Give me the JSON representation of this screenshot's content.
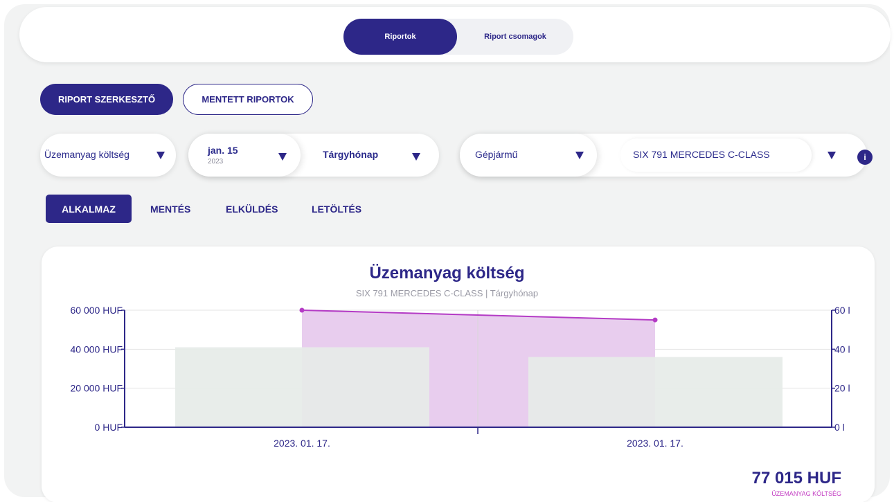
{
  "top_tabs": {
    "reports": "Riportok",
    "packages": "Riport csomagok"
  },
  "mode_buttons": {
    "editor": "RIPORT SZERKESZTŐ",
    "saved": "MENTETT RIPORTOK"
  },
  "filters": {
    "metric": "Üzemanyag költség",
    "date_main": "jan. 15",
    "date_year": "2023",
    "period": "Tárgyhónap",
    "entity_type": "Gépjármű",
    "vehicle": "SIX 791 MERCEDES C-CLASS",
    "info": "i"
  },
  "actions": {
    "apply": "ALKALMAZ",
    "save": "MENTÉS",
    "send": "ELKÜLDÉS",
    "download": "LETÖLTÉS"
  },
  "colors": {
    "primary": "#2d2788",
    "bar": "#e6ece8",
    "area": "#e8cdee",
    "line": "#b43bc5",
    "total_label": "#c23bc2"
  },
  "chart_data": {
    "type": "bar",
    "title": "Üzemanyag költség",
    "subtitle": "SIX 791 MERCEDES C-CLASS | Tárgyhónap",
    "categories": [
      "2023. 01. 17.",
      "2023. 01. 17."
    ],
    "y_left": {
      "ticks": [
        "0 HUF",
        "20 000 HUF",
        "40 000 HUF",
        "60 000 HUF"
      ],
      "range": [
        0,
        60000
      ]
    },
    "y_right": {
      "ticks": [
        "0 l",
        "20 l",
        "40 l",
        "60 l"
      ],
      "range": [
        0,
        60
      ]
    },
    "series": [
      {
        "type": "bar",
        "values": [
          41000,
          36000
        ]
      },
      {
        "type": "line",
        "values": [
          60,
          55
        ]
      }
    ],
    "grid": true
  },
  "summary": {
    "total": "77 015 HUF",
    "label": "ÜZEMANYAG KÖLTSÉG"
  }
}
